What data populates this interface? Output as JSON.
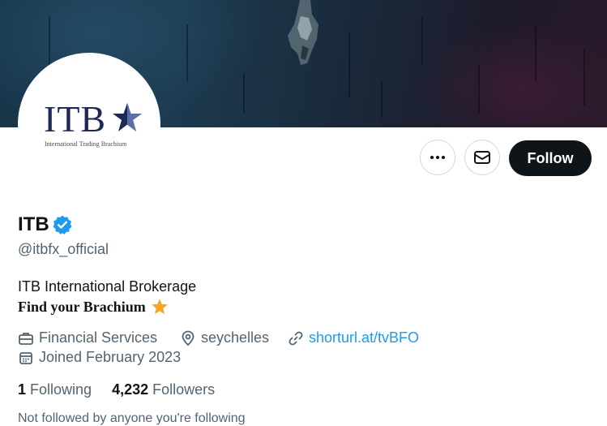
{
  "profile": {
    "name": "ITB",
    "handle": "@itbfx_official",
    "bio_line1": "ITB International Brokerage",
    "bio_line2": "Find your Brachium",
    "category": "Financial Services",
    "location": "seychelles",
    "website": "shorturl.at/tvBFO",
    "joined": "Joined February 2023",
    "following_count": "1",
    "following_label": "Following",
    "followers_count": "4,232",
    "followers_label": "Followers",
    "not_followed_text": "Not followed by anyone you're following"
  },
  "avatar": {
    "logo_text": "ITB",
    "logo_tagline": "International Trading Brachium"
  },
  "actions": {
    "follow_label": "Follow",
    "more_icon": "more-horizontal-icon",
    "message_icon": "envelope-icon"
  },
  "colors": {
    "accent": "#1d9bf0",
    "primary_button": "#0f1419",
    "secondary_text": "#536471",
    "logo_navy": "#1c2a55",
    "star": "#f5a623"
  }
}
